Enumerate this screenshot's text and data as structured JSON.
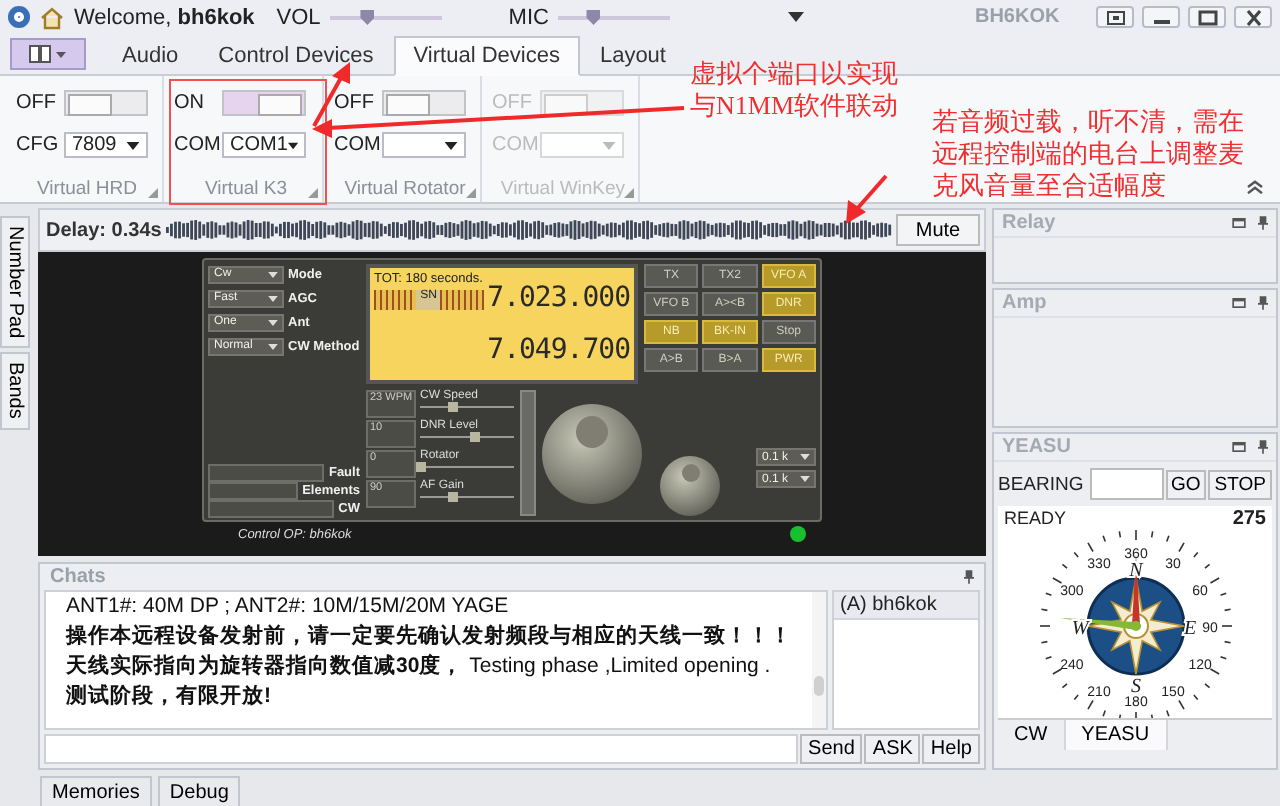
{
  "window": {
    "greeting": "Welcome, **bh6kok**",
    "title": "BH6KOK",
    "volume": {
      "label": "VOL",
      "level": 0.32
    },
    "mic": {
      "label": "MIC",
      "level": 0.3
    }
  },
  "tabs": [
    {
      "label": "Audio",
      "selected": false
    },
    {
      "label": "Control Devices",
      "selected": false
    },
    {
      "label": "Virtual Devices",
      "selected": true
    },
    {
      "label": "Layout",
      "selected": false
    }
  ],
  "ribbon": {
    "groups": [
      {
        "label": "Virtual HRD",
        "disabled": false,
        "toggle": {
          "label": "OFF",
          "on": false
        },
        "field": {
          "label": "CFG",
          "value": "7809"
        }
      },
      {
        "label": "Virtual K3",
        "disabled": false,
        "toggle": {
          "label": "ON",
          "on": true
        },
        "field": {
          "label": "COM",
          "value": "COM1"
        }
      },
      {
        "label": "Virtual Rotator",
        "disabled": false,
        "toggle": {
          "label": "OFF",
          "on": false
        },
        "field": {
          "label": "COM"
        }
      },
      {
        "label": "Virtual WinKey",
        "disabled": true,
        "toggle": {
          "label": "OFF",
          "on": false
        },
        "field": {
          "label": "COM"
        }
      }
    ]
  },
  "annotations": [
    {
      "lines": [
        "虚拟个端口以实现",
        "与N1MM软件联动"
      ]
    },
    {
      "lines": [
        "若音频过载，听不清，需在",
        "远程控制端的电台上调整麦",
        "克风音量至合适幅度"
      ]
    }
  ],
  "side_tabs": [
    {
      "label": "Number Pad",
      "selected": false
    },
    {
      "label": "Bands",
      "selected": false
    }
  ],
  "delay": {
    "label": "Delay: 0.34s",
    "button": "Mute"
  },
  "radio": {
    "selectors": [
      {
        "label": "Mode",
        "value": "Cw"
      },
      {
        "label": "AGC",
        "value": "Fast"
      },
      {
        "label": "Ant",
        "value": "One"
      },
      {
        "label": "CW Method",
        "value": "Normal"
      }
    ],
    "display": {
      "timer": "TOT: 180 seconds.",
      "meter": "SN",
      "freq_a": "7.023.000",
      "freq_b": "7.049.700"
    },
    "buttons": [
      {
        "label": "TX",
        "on": false
      },
      {
        "label": "TX2",
        "on": false
      },
      {
        "label": "VFO A",
        "on": true
      },
      {
        "label": "VFO B",
        "on": false
      },
      {
        "label": "A><B",
        "on": false
      },
      {
        "label": "DNR",
        "on": true
      },
      {
        "label": "NB",
        "on": true
      },
      {
        "label": "BK-IN",
        "on": true
      },
      {
        "label": "Stop",
        "on": false
      },
      {
        "label": "A>B",
        "on": false
      },
      {
        "label": "B>A",
        "on": false
      },
      {
        "label": "PWR",
        "on": true
      }
    ],
    "status_fields": [
      "Fault",
      "Elements",
      "CW"
    ],
    "controls": [
      {
        "value": "23 WPM",
        "label": "CW Speed",
        "level": 0.35
      },
      {
        "value": "10",
        "label": "DNR Level",
        "level": 0.58
      },
      {
        "value": "0",
        "label": "Rotator",
        "level": 0
      },
      {
        "value": "90",
        "label": "AF Gain",
        "level": 0.35
      }
    ],
    "steps": [
      "0.1 k",
      "0.1 k"
    ],
    "operator": "Control OP: bh6kok"
  },
  "chats": {
    "title": "Chats",
    "lines": [
      {
        "text": "ANT1#: 40M DP ; ANT2#: 10M/15M/20M YAGE",
        "bold": false
      },
      {
        "text": "操作本远程设备发射前，请一定要先确认发射频段与相应的天线一致！！！",
        "bold": true
      },
      {
        "text": "**天线实际指向为旋转器指向数值减30度，** Testing phase ,Limited opening .",
        "bold": false
      },
      {
        "text": "测试阶段，有限开放!",
        "bold": true
      }
    ],
    "users": [
      {
        "name": "(A) bh6kok",
        "selected": true
      }
    ],
    "buttons": [
      "Send",
      "ASK",
      "Help"
    ]
  },
  "panels": [
    {
      "title": "Relay"
    },
    {
      "title": "Amp"
    }
  ],
  "rotator": {
    "title": "YEASU",
    "bearing_label": "BEARING",
    "buttons": [
      "GO",
      "STOP"
    ],
    "status": "READY",
    "reading": "275",
    "dial_labels": [
      "360",
      "30",
      "60",
      "90",
      "120",
      "150",
      "180",
      "210",
      "240",
      "300",
      "330"
    ],
    "cardinals": [
      "N",
      "E",
      "S",
      "W"
    ],
    "tabs": [
      {
        "label": "CW",
        "selected": false
      },
      {
        "label": "YEASU",
        "selected": true
      }
    ]
  },
  "bottom_tabs": [
    {
      "label": "Memories",
      "selected": false
    },
    {
      "label": "Debug",
      "selected": false
    }
  ]
}
